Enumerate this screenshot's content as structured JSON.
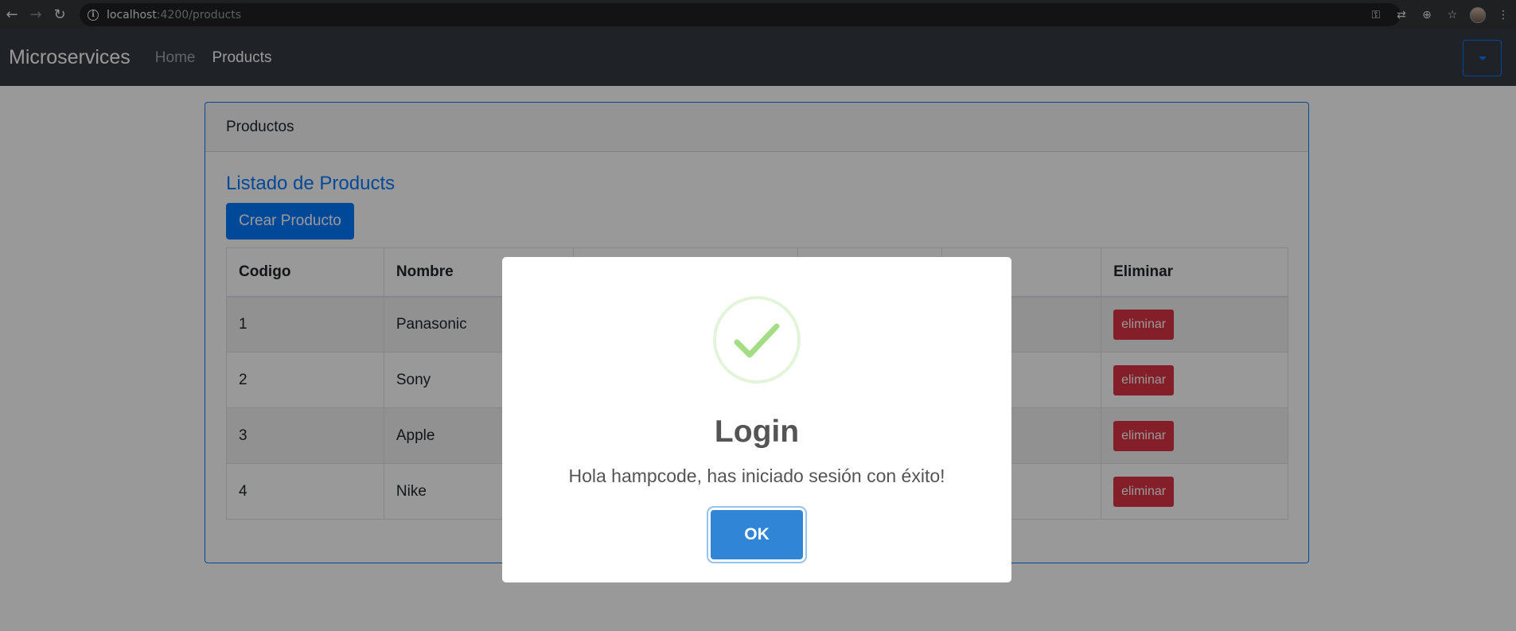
{
  "browser": {
    "url_host": "localhost",
    "url_path": ":4200/products"
  },
  "navbar": {
    "brand": "Microservices",
    "links": [
      {
        "label": "Home"
      },
      {
        "label": "Products"
      }
    ]
  },
  "card": {
    "header": "Productos",
    "title": "Listado de Products",
    "create_button": "Crear Producto"
  },
  "table": {
    "headers": [
      "Codigo",
      "Nombre",
      "",
      "",
      "",
      "Eliminar"
    ],
    "rows": [
      {
        "codigo": "1",
        "nombre": "Panasonic",
        "action": "eliminar"
      },
      {
        "codigo": "2",
        "nombre": "Sony",
        "action": "eliminar"
      },
      {
        "codigo": "3",
        "nombre": "Apple",
        "action": "eliminar"
      },
      {
        "codigo": "4",
        "nombre": "Nike",
        "action": "eliminar"
      }
    ]
  },
  "modal": {
    "icon": "success-check-icon",
    "title": "Login",
    "text": "Hola hampcode, has iniciado sesión con éxito!",
    "ok_label": "OK"
  },
  "colors": {
    "primary": "#007bff",
    "danger": "#dc3545",
    "navbar_bg": "#343a40",
    "modal_button": "#3085d6",
    "success_check": "#a5dc86"
  }
}
